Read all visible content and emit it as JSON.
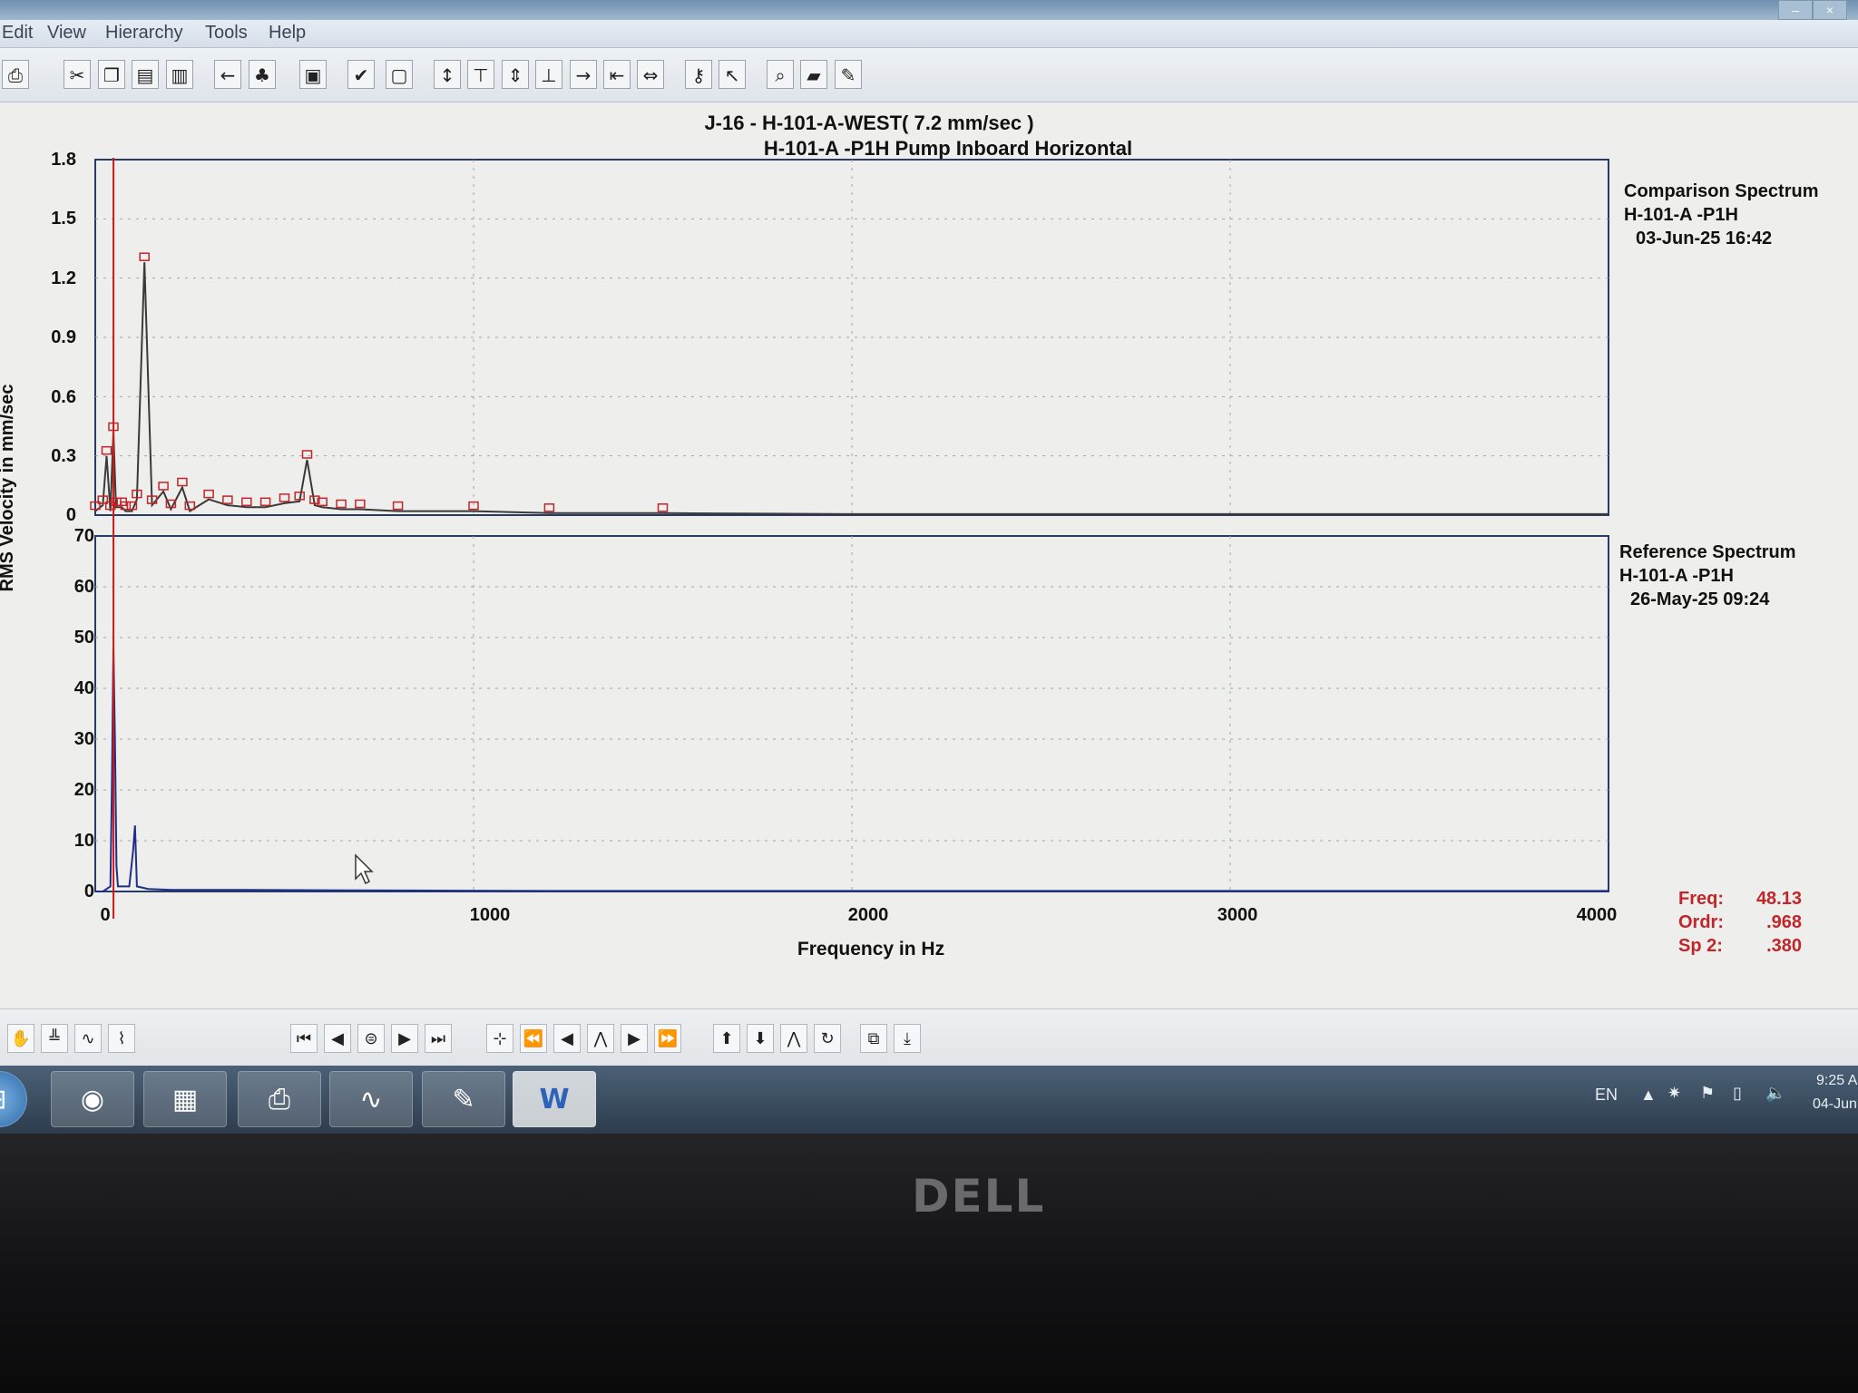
{
  "menu": {
    "items": [
      "Edit",
      "View",
      "Hierarchy",
      "Tools",
      "Help"
    ]
  },
  "window": {
    "minimize": "–",
    "close": "×"
  },
  "toolbar": {
    "icons": [
      "print-icon",
      "cut-icon",
      "copy-icon",
      "paste-icon",
      "paste-special-icon",
      "back-icon",
      "tree-icon",
      "window-icon",
      "checkmark-icon",
      "display-icon",
      "cursor-range-icon",
      "cursor-top-icon",
      "cursor-mid-icon",
      "cursor-bottom-icon",
      "marker-right-icon",
      "marker-left-icon",
      "marker-span-icon",
      "key-icon",
      "pointer-icon",
      "zoom-icon",
      "open-folder-icon",
      "edit-icon"
    ]
  },
  "plot": {
    "title_line1": "J-16 - H-101-A-WEST( 7.2 mm/sec )",
    "title_line2": "H-101-A   -P1H   Pump Inboard Horizontal",
    "ylabel": "RMS Velocity in mm/sec",
    "xlabel": "Frequency in Hz",
    "x_ticks": [
      "0",
      "1000",
      "2000",
      "3000",
      "4000"
    ],
    "top_y_ticks": [
      "0",
      "0.3",
      "0.6",
      "0.9",
      "1.2",
      "1.5",
      "1.8"
    ],
    "bottom_y_ticks": [
      "0",
      "10",
      "20",
      "30",
      "40",
      "50",
      "60",
      "70"
    ],
    "comparison": {
      "label": "Comparison Spectrum",
      "point": "H-101-A   -P1H",
      "date": "03-Jun-25  16:42"
    },
    "reference": {
      "label": "Reference Spectrum",
      "point": "H-101-A   -P1H",
      "date": "26-May-25  09:24"
    },
    "cursor": {
      "freq_label": "Freq:",
      "freq": "48.13",
      "order_label": "Ordr:",
      "order": ".968",
      "sp_label": "Sp 2:",
      "sp": ".380"
    }
  },
  "chart_data": [
    {
      "type": "line",
      "title": "Comparison Spectrum",
      "xlabel": "Frequency in Hz",
      "ylabel": "RMS Velocity in mm/sec",
      "xlim": [
        0,
        4000
      ],
      "ylim": [
        0,
        1.8
      ],
      "grid": true,
      "x": [
        0,
        20,
        30,
        40,
        48,
        55,
        70,
        80,
        97,
        110,
        130,
        150,
        180,
        200,
        230,
        250,
        300,
        350,
        400,
        450,
        500,
        540,
        560,
        580,
        600,
        650,
        700,
        800,
        1000,
        1200,
        1500,
        2000,
        3000,
        4000
      ],
      "y": [
        0.02,
        0.05,
        0.3,
        0.02,
        0.42,
        0.04,
        0.04,
        0.02,
        0.02,
        0.08,
        1.28,
        0.05,
        0.12,
        0.03,
        0.14,
        0.02,
        0.08,
        0.05,
        0.04,
        0.04,
        0.06,
        0.07,
        0.28,
        0.05,
        0.04,
        0.03,
        0.03,
        0.02,
        0.02,
        0.01,
        0.01,
        0.005,
        0.005,
        0.005
      ]
    },
    {
      "type": "line",
      "title": "Reference Spectrum",
      "xlabel": "Frequency in Hz",
      "ylabel": "RMS Velocity in mm/sec",
      "xlim": [
        0,
        4000
      ],
      "ylim": [
        0,
        70
      ],
      "grid": true,
      "x": [
        0,
        20,
        40,
        44,
        48,
        52,
        56,
        60,
        90,
        100,
        105,
        110,
        140,
        200,
        400,
        800,
        1200,
        4000
      ],
      "y": [
        0,
        0,
        1,
        20,
        48,
        30,
        5,
        1,
        1,
        8,
        13,
        1,
        0.5,
        0.3,
        0.3,
        0.2,
        0.1,
        0.1
      ]
    }
  ],
  "bottom_toolbar": {
    "icons": [
      "hand-icon",
      "spectrum-icon",
      "waveform-icon",
      "trend-icon",
      "first-icon",
      "prev-icon",
      "record-icon",
      "next-icon",
      "last-icon",
      "cursor-icon",
      "fast-back-icon",
      "step-back-icon",
      "peak-icon",
      "step-forward-icon",
      "fast-forward-icon",
      "up-arrow-icon",
      "down-arrow-icon",
      "harmonic-icon",
      "refresh-icon",
      "zoom-box-icon",
      "export-icon"
    ]
  },
  "taskbar": {
    "apps": [
      "start-icon",
      "firefox-icon",
      "explorer-icon",
      "printer-icon",
      "analyzer-icon",
      "notepad-icon",
      "word-icon"
    ],
    "lang": "EN",
    "time": "9:25 A",
    "date": "04-Jun"
  },
  "brand": "DELL"
}
